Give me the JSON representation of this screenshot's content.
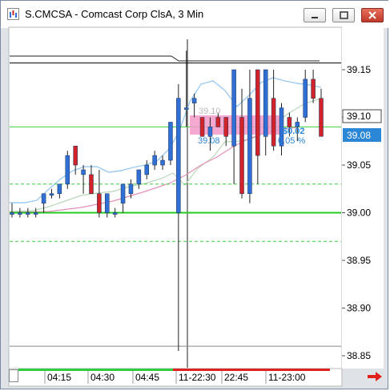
{
  "window": {
    "title": "S.CMCSA - Comcast Corp ClsA, 3 Min"
  },
  "colors": {
    "up_candle": "#2f6fd6",
    "down_candle": "#d2232a",
    "ref_line": "#3ccf3c",
    "band_fill": "#f49ac8",
    "price_label_bg": "#2b86d6",
    "session_bar": "#2ecc40",
    "session_bar_post": "#d22"
  },
  "price_axis": {
    "ticks": [
      "39.15",
      "39.10",
      "39.05",
      "39.00",
      "38.95",
      "38.90",
      "38.85"
    ],
    "last_price_label": "39.08",
    "marker_label": "39.10"
  },
  "time_axis": {
    "labels": [
      "04:15",
      "04:30",
      "04:45",
      "11-22:30",
      "22:45",
      "11-23:00"
    ]
  },
  "overlay": {
    "price_left": "39.08",
    "price_top_faded": "39.10",
    "change_value": "$0.02",
    "change_pct": "0.05 %"
  },
  "chart_data": {
    "type": "candlestick",
    "interval": "3 Min",
    "ylim": [
      38.84,
      39.19
    ],
    "reference_lines": [
      {
        "price": 39.157,
        "style": "solid",
        "color": "#000000"
      },
      {
        "price": 39.09,
        "style": "solid",
        "color": "#3ccf3c"
      },
      {
        "price": 39.03,
        "style": "dashed",
        "color": "#3ccf3c"
      },
      {
        "price": 39.0,
        "style": "solid",
        "color": "#22cc22"
      },
      {
        "price": 38.97,
        "style": "dashed",
        "color": "#3ccf3c"
      },
      {
        "price": 38.86,
        "style": "solid",
        "color": "#888888"
      }
    ],
    "candles": [
      {
        "o": 39.0,
        "h": 39.01,
        "l": 38.995,
        "c": 39.0
      },
      {
        "o": 39.0,
        "h": 39.005,
        "l": 38.995,
        "c": 39.0
      },
      {
        "o": 39.0,
        "h": 39.005,
        "l": 38.995,
        "c": 39.0
      },
      {
        "o": 39.0,
        "h": 39.005,
        "l": 38.995,
        "c": 39.0
      },
      {
        "o": 39.01,
        "h": 39.02,
        "l": 39.0,
        "c": 39.02
      },
      {
        "o": 39.02,
        "h": 39.025,
        "l": 39.015,
        "c": 39.02
      },
      {
        "o": 39.02,
        "h": 39.03,
        "l": 39.015,
        "c": 39.03
      },
      {
        "o": 39.03,
        "h": 39.065,
        "l": 39.025,
        "c": 39.06
      },
      {
        "o": 39.07,
        "h": 39.07,
        "l": 39.04,
        "c": 39.05
      },
      {
        "o": 39.04,
        "h": 39.05,
        "l": 39.02,
        "c": 39.045
      },
      {
        "o": 39.04,
        "h": 39.05,
        "l": 39.02,
        "c": 39.02
      },
      {
        "o": 39.02,
        "h": 39.045,
        "l": 38.995,
        "c": 39.0
      },
      {
        "o": 39.0,
        "h": 39.02,
        "l": 38.995,
        "c": 39.02
      },
      {
        "o": 39.0,
        "h": 39.005,
        "l": 38.995,
        "c": 39.0
      },
      {
        "o": 39.01,
        "h": 39.03,
        "l": 39.0,
        "c": 39.03
      },
      {
        "o": 39.02,
        "h": 39.035,
        "l": 39.015,
        "c": 39.03
      },
      {
        "o": 39.03,
        "h": 39.045,
        "l": 39.025,
        "c": 39.045
      },
      {
        "o": 39.04,
        "h": 39.055,
        "l": 39.035,
        "c": 39.05
      },
      {
        "o": 39.05,
        "h": 39.065,
        "l": 39.045,
        "c": 39.06
      },
      {
        "o": 39.05,
        "h": 39.06,
        "l": 39.045,
        "c": 39.055
      },
      {
        "o": 39.055,
        "h": 39.095,
        "l": 39.05,
        "c": 39.095
      },
      {
        "o": 39.0,
        "h": 39.135,
        "l": 38.855,
        "c": 39.12
      },
      {
        "o": 39.11,
        "h": 39.17,
        "l": 39.09,
        "c": 39.11
      },
      {
        "o": 39.115,
        "h": 39.125,
        "l": 39.1,
        "c": 39.12
      },
      {
        "o": 39.1,
        "h": 39.1,
        "l": 39.08,
        "c": 39.08
      },
      {
        "o": 39.08,
        "h": 39.1,
        "l": 39.065,
        "c": 39.09
      },
      {
        "o": 39.1,
        "h": 39.105,
        "l": 39.09,
        "c": 39.09
      },
      {
        "o": 39.1,
        "h": 39.1,
        "l": 39.07,
        "c": 39.08
      },
      {
        "o": 39.07,
        "h": 39.15,
        "l": 39.03,
        "c": 39.15
      },
      {
        "o": 39.1,
        "h": 39.13,
        "l": 39.015,
        "c": 39.02
      },
      {
        "o": 39.02,
        "h": 39.15,
        "l": 39.01,
        "c": 39.12
      },
      {
        "o": 39.15,
        "h": 39.15,
        "l": 39.03,
        "c": 39.06
      },
      {
        "o": 39.08,
        "h": 39.15,
        "l": 39.06,
        "c": 39.15
      },
      {
        "o": 39.12,
        "h": 39.15,
        "l": 39.065,
        "c": 39.07
      },
      {
        "o": 39.07,
        "h": 39.115,
        "l": 39.06,
        "c": 39.11
      },
      {
        "o": 39.1,
        "h": 39.105,
        "l": 39.08,
        "c": 39.09
      },
      {
        "o": 39.09,
        "h": 39.1,
        "l": 39.075,
        "c": 39.095
      },
      {
        "o": 39.1,
        "h": 39.15,
        "l": 39.095,
        "c": 39.14
      },
      {
        "o": 39.14,
        "h": 39.15,
        "l": 39.115,
        "c": 39.12
      },
      {
        "o": 39.12,
        "h": 39.13,
        "l": 39.08,
        "c": 39.08
      }
    ]
  }
}
